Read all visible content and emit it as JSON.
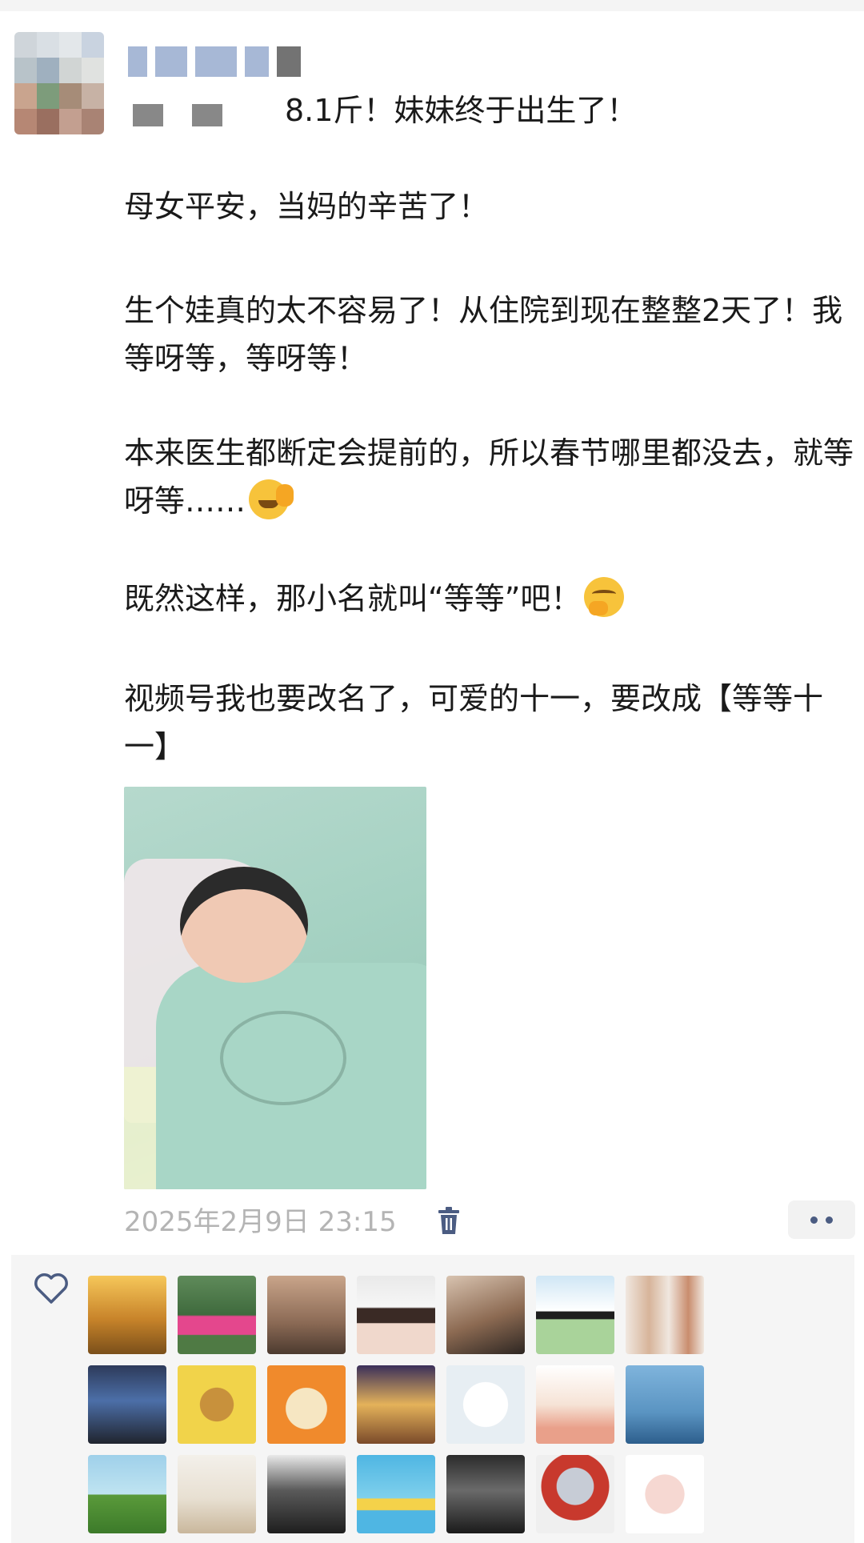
{
  "post": {
    "title": "8.1斤！妹妹终于出生了！",
    "paragraphs": [
      "母女平安，当妈的辛苦了！",
      "生个娃真的太不容易了！从住院到现在整整2天了！我等呀等，等呀等！",
      "本来医生都断定会提前的，所以春节哪里都没去，就等呀等……",
      "既然这样，那小名就叫“等等”吧！",
      "视频号我也要改名了，可爱的十一，要改成【等等十一】"
    ],
    "emojis": [
      "facepalm-emoji",
      "thinking-emoji"
    ],
    "timestamp": "2025年2月9日 23:15"
  },
  "icons": {
    "delete": "trash-icon",
    "more": "more-dots-icon",
    "like": "heart-icon"
  },
  "colors": {
    "timestamp": "#b4b4b4",
    "accent": "#4b5c82",
    "likes_bg": "#f5f5f5"
  },
  "likers": [
    {
      "name": "liker-1",
      "bg": "linear-gradient(180deg,#f6c75a,#c8842a 55%,#7a4f1a)"
    },
    {
      "name": "liker-2",
      "bg": "linear-gradient(180deg,#5f8b5a,#3f6a3d 50%,#e4478d 52%,#e4478d 75%,#4f7a44 76%)"
    },
    {
      "name": "liker-3",
      "bg": "linear-gradient(180deg,#c9a58a,#8b6a55 60%,#4c3a2f)"
    },
    {
      "name": "liker-4",
      "bg": "linear-gradient(180deg,#e9e9e9,#f6f6f6 40%,#3a2a25 42%,#3a2a25 60%,#f0d8cc 61%)"
    },
    {
      "name": "liker-5",
      "bg": "linear-gradient(160deg,#d8c3b0,#8c6a52 55%,#2d2622)"
    },
    {
      "name": "liker-6",
      "bg": "linear-gradient(180deg,#cfe6f5,#ffffff 45%,#1e1e1e 46%,#1e1e1e 55%,#a9d39a 56%)"
    },
    {
      "name": "liker-7",
      "bg": "linear-gradient(90deg,#f0e7df,#d7b49a 30%,#f0e7df 55%,#c98d6e 80%,#f0e7df)"
    },
    {
      "name": "liker-8",
      "bg": "linear-gradient(180deg,#2d3a5a,#4c6fa8 45%,#20242e)"
    },
    {
      "name": "liker-9",
      "bg": "radial-gradient(circle at 50% 50%,#c8913c 30%,#f1d34a 31%)"
    },
    {
      "name": "liker-10",
      "bg": "radial-gradient(circle at 50% 55%,#f6e6c2 35%,#f08a2c 36%)"
    },
    {
      "name": "liker-11",
      "bg": "linear-gradient(180deg,#3a2f5a,#e4b25a 50%,#7a4a2a)"
    },
    {
      "name": "liker-12",
      "bg": "radial-gradient(circle at 50% 50%,#ffffff 40%,#e7eef3 41%)"
    },
    {
      "name": "liker-13",
      "bg": "linear-gradient(180deg,#ffffff,#f6e3d6 50%,#e9a08a 80%)"
    },
    {
      "name": "liker-14",
      "bg": "linear-gradient(180deg,#7fb4dc,#5a94c2 60%,#2d5e8c)"
    },
    {
      "name": "liker-15",
      "bg": "linear-gradient(180deg,#9fd0ea,#bfe4f1 50%,#5a9a3a 51%,#3c7a2a)"
    },
    {
      "name": "liker-16",
      "bg": "linear-gradient(180deg,#f3f0ea,#e8e0d2 55%,#c9b79c)"
    },
    {
      "name": "liker-17",
      "bg": "linear-gradient(180deg,#e9e9e9,#5a5a5a 45%,#1e1e1e)"
    },
    {
      "name": "liker-18",
      "bg": "linear-gradient(180deg,#4fb6e3,#7fd0ec 55%,#f4d24a 56%,#f4d24a 70%,#4fb6e3 71%)"
    },
    {
      "name": "liker-19",
      "bg": "linear-gradient(180deg,#2b2b2b,#6a6a6a 45%,#1b1b1b)"
    },
    {
      "name": "liker-20",
      "bg": "radial-gradient(circle at 50% 40%,#c7ccd6 30%,#c8392d 31%,#c8392d 55%,#efefef 56%)"
    },
    {
      "name": "liker-21",
      "bg": "radial-gradient(circle at 50% 50%,#f6d8d2 35%,#ffffff 36%)"
    }
  ]
}
